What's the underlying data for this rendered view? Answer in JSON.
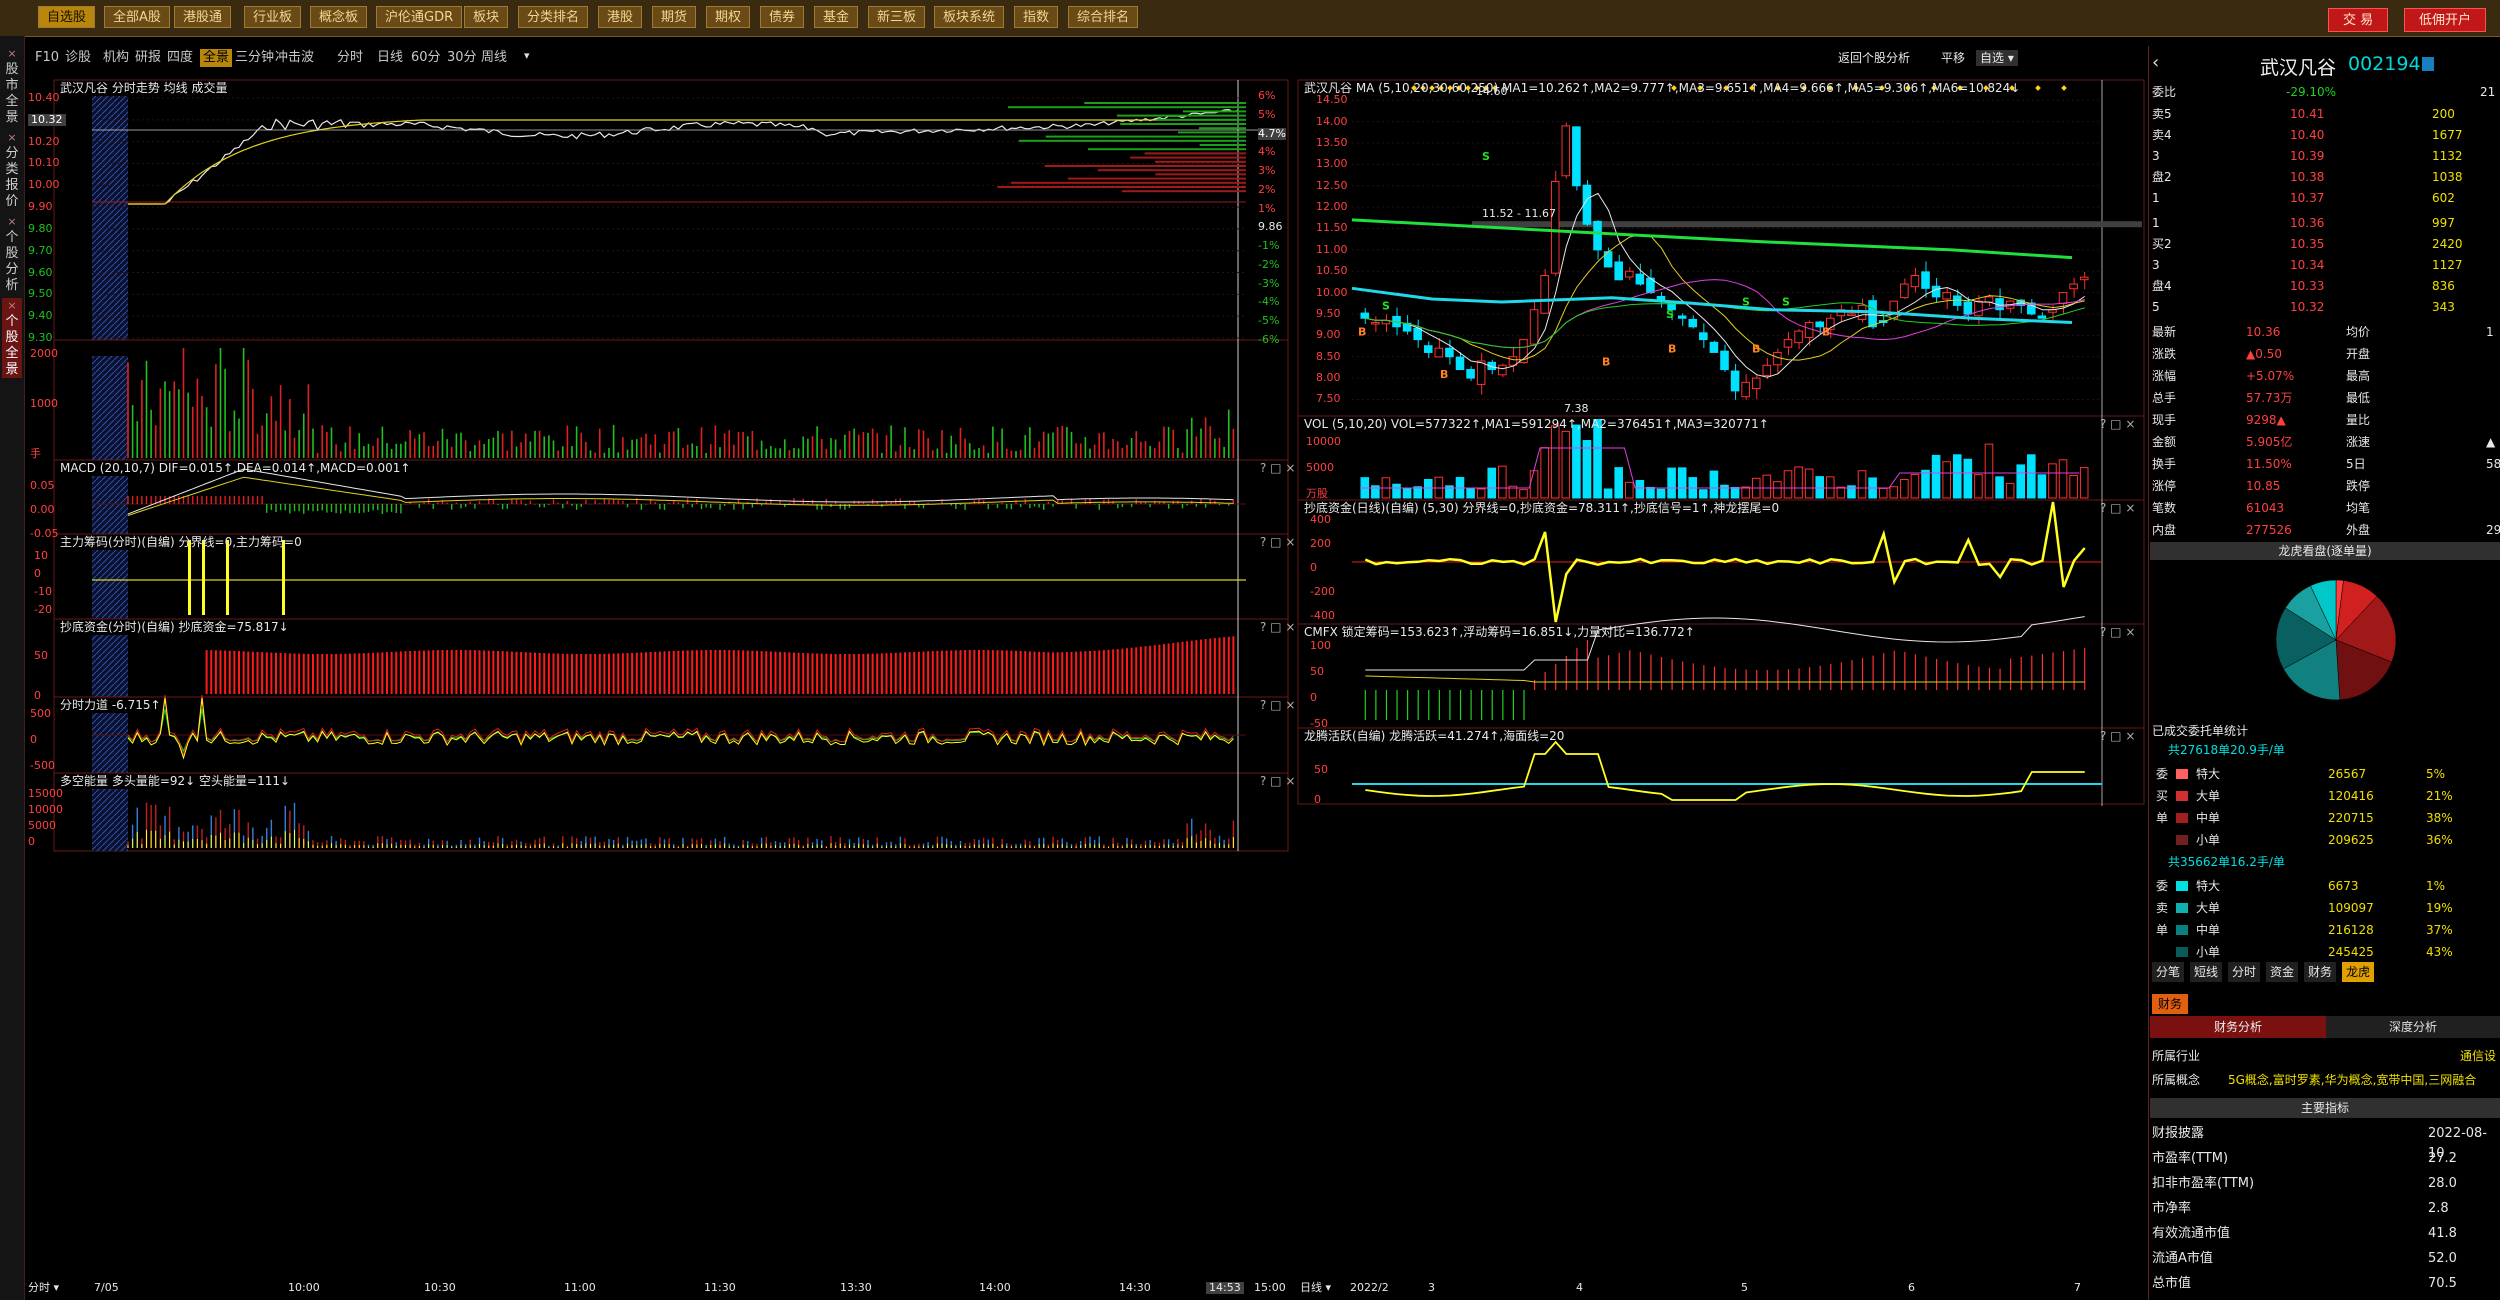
{
  "topbar": {
    "buttons": [
      "自选股",
      "全部A股",
      "港股通",
      "行业板",
      "概念板",
      "沪伦通GDR",
      "板块",
      "分类排名",
      "港股",
      "期货",
      "期权",
      "债券",
      "基金",
      "新三板",
      "板块系统",
      "指数",
      "综合排名"
    ],
    "trade_btn": "交 易",
    "open_btn": "低佣开户"
  },
  "sidebar": {
    "tabs": [
      "股市全景",
      "分类报价",
      "个股分析",
      "个股全景"
    ]
  },
  "tabs": [
    "F10",
    "诊股",
    "机构",
    "研报",
    "四度",
    "全景",
    "三分钟",
    "冲击波",
    "分时",
    "日线",
    "60分",
    "30分",
    "周线"
  ],
  "left": {
    "main_title": "武汉凡谷 分时走势 均线 成交量",
    "price_ticks": [
      "10.40",
      "10.32",
      "10.20",
      "10.10",
      "10.00",
      "9.90",
      "9.80",
      "9.70",
      "9.60",
      "9.50",
      "9.40",
      "9.30"
    ],
    "pct_ticks": [
      "6%",
      "5%",
      "4.7%",
      "4%",
      "3%",
      "2%",
      "1%",
      "9.86",
      "-1%",
      "-2%",
      "-3%",
      "-4%",
      "-5%",
      "-6%"
    ],
    "vol_ticks": [
      "2000",
      "1000",
      "手"
    ],
    "macd_title": "MACD (20,10,7) DIF=0.015↑,DEA=0.014↑,MACD=0.001↑",
    "macd_ticks": [
      "0.05",
      "0.00",
      "-0.05"
    ],
    "zl_title": "主力筹码(分时)(自编) 分界线=0,主力筹码=0",
    "zl_ticks": [
      "10",
      "0",
      "-10",
      "-20"
    ],
    "cd_title": "抄底资金(分时)(自编) 抄底资金=75.817↓",
    "cd_ticks": [
      "50",
      "0"
    ],
    "fl_title": "分时力道 -6.715↑",
    "fl_ticks": [
      "500",
      "0",
      "-500"
    ],
    "dk_title": "多空能量 多头量能=92↓ 空头能量=111↓",
    "dk_ticks": [
      "15000",
      "10000",
      "5000",
      "0"
    ],
    "time_ticks": [
      "7/05",
      "10:00",
      "10:30",
      "11:00",
      "11:30",
      "13:30",
      "14:00",
      "14:30",
      "14:53",
      "15:00"
    ],
    "time_label": "分时"
  },
  "right": {
    "main_title": "武汉凡谷 MA (5,10,20,30,60,250) MA1=10.262↑,MA2=9.777↑,MA3=9.651↑,MA4=9.666↑,MA5=9.306↑,MA6=10.824↓",
    "ctrl": [
      "返回个股分析",
      "平移",
      "自选"
    ],
    "price_ticks": [
      "14.50",
      "14.00",
      "13.50",
      "13.00",
      "12.50",
      "12.00",
      "11.50",
      "11.00",
      "10.50",
      "10.00",
      "9.50",
      "9.00",
      "8.50",
      "8.00",
      "7.50"
    ],
    "hi_label": "14.60",
    "band_label": "11.52 - 11.67",
    "lo_label": "7.38",
    "vol_title": "VOL (5,10,20) VOL=577322↑,MA1=591294↑,MA2=376451↑,MA3=320771↑",
    "vol_ticks": [
      "10000",
      "5000",
      "万股"
    ],
    "cd_title": "抄底资金(日线)(自编) (5,30) 分界线=0,抄底资金=78.311↑,抄底信号=1↑,神龙摆尾=0",
    "cd_ticks": [
      "400",
      "200",
      "0",
      "-200",
      "-400"
    ],
    "cmfx_title": "CMFX 锁定筹码=153.623↑,浮动筹码=16.851↓,力量对比=136.772↑",
    "cmfx_ticks": [
      "100",
      "50",
      "0",
      "-50"
    ],
    "lt_title": "龙腾活跃(自编) 龙腾活跃=41.274↑,海面线=20",
    "lt_ticks": [
      "50",
      "0"
    ],
    "date_ticks": [
      "2022/2",
      "3",
      "4",
      "5",
      "6",
      "7"
    ],
    "date_label": "日线"
  },
  "quote": {
    "name": "武汉凡谷",
    "code": "002194",
    "weibi_label": "委比",
    "weibi": "-29.10%",
    "weicha": "21",
    "sells": [
      [
        "卖5",
        "10.41",
        "200"
      ],
      [
        "卖4",
        "10.40",
        "1677"
      ],
      [
        "3",
        "10.39",
        "1132"
      ],
      [
        "盘2",
        "10.38",
        "1038"
      ],
      [
        "1",
        "10.37",
        "602"
      ]
    ],
    "buys": [
      [
        "1",
        "10.36",
        "997"
      ],
      [
        "买2",
        "10.35",
        "2420"
      ],
      [
        "3",
        "10.34",
        "1127"
      ],
      [
        "盘4",
        "10.33",
        "836"
      ],
      [
        "5",
        "10.32",
        "343"
      ]
    ],
    "stats": [
      [
        "最新",
        "10.36",
        "均价",
        "1"
      ],
      [
        "涨跌",
        "▲0.50",
        "开盘",
        ""
      ],
      [
        "涨幅",
        "+5.07%",
        "最高",
        ""
      ],
      [
        "总手",
        "57.73万",
        "最低",
        ""
      ],
      [
        "现手",
        "9298▲",
        "量比",
        ""
      ],
      [
        "金额",
        "5.905亿",
        "涨速",
        "▲"
      ],
      [
        "换手",
        "11.50%",
        "5日",
        "58."
      ],
      [
        "涨停",
        "10.85",
        "跌停",
        ""
      ],
      [
        "笔数",
        "61043",
        "均笔",
        ""
      ],
      [
        "内盘",
        "277526",
        "外盘",
        "29"
      ]
    ],
    "pie_title": "龙虎看盘(逐单量)",
    "ytx_title": "已成交委托单统计",
    "buy_total": "共27618单20.9手/单",
    "buy_rows": [
      [
        "特大",
        "26567",
        "5%"
      ],
      [
        "大单",
        "120416",
        "21%"
      ],
      [
        "中单",
        "220715",
        "38%"
      ],
      [
        "小单",
        "209625",
        "36%"
      ]
    ],
    "buy_side": [
      "委",
      "买",
      "单"
    ],
    "sell_total": "共35662单16.2手/单",
    "sell_rows": [
      [
        "特大",
        "6673",
        "1%"
      ],
      [
        "大单",
        "109097",
        "19%"
      ],
      [
        "中单",
        "216128",
        "37%"
      ],
      [
        "小单",
        "245425",
        "43%"
      ]
    ],
    "sell_side": [
      "委",
      "卖",
      "单"
    ],
    "btabs": [
      "分笔",
      "短线",
      "分时",
      "资金",
      "财务",
      "龙虎"
    ],
    "fin_tab": "财务",
    "fin_sub": [
      "财务分析",
      "深度分析"
    ],
    "fin_rows": [
      [
        "所属行业",
        "通信设"
      ],
      [
        "所属概念",
        "5G概念,富时罗素,华为概念,宽带中国,三网融合"
      ]
    ],
    "main_idx": "主要指标",
    "idx_rows": [
      [
        "财报披露",
        "2022-08-10"
      ],
      [
        "市盈率(TTM)",
        "27.2"
      ],
      [
        "扣非市盈率(TTM)",
        "28.0"
      ],
      [
        "市净率",
        "2.8"
      ],
      [
        "有效流通市值",
        "41.8"
      ],
      [
        "流通A市值",
        "52.0"
      ],
      [
        "总市值",
        "70.5"
      ]
    ]
  }
}
